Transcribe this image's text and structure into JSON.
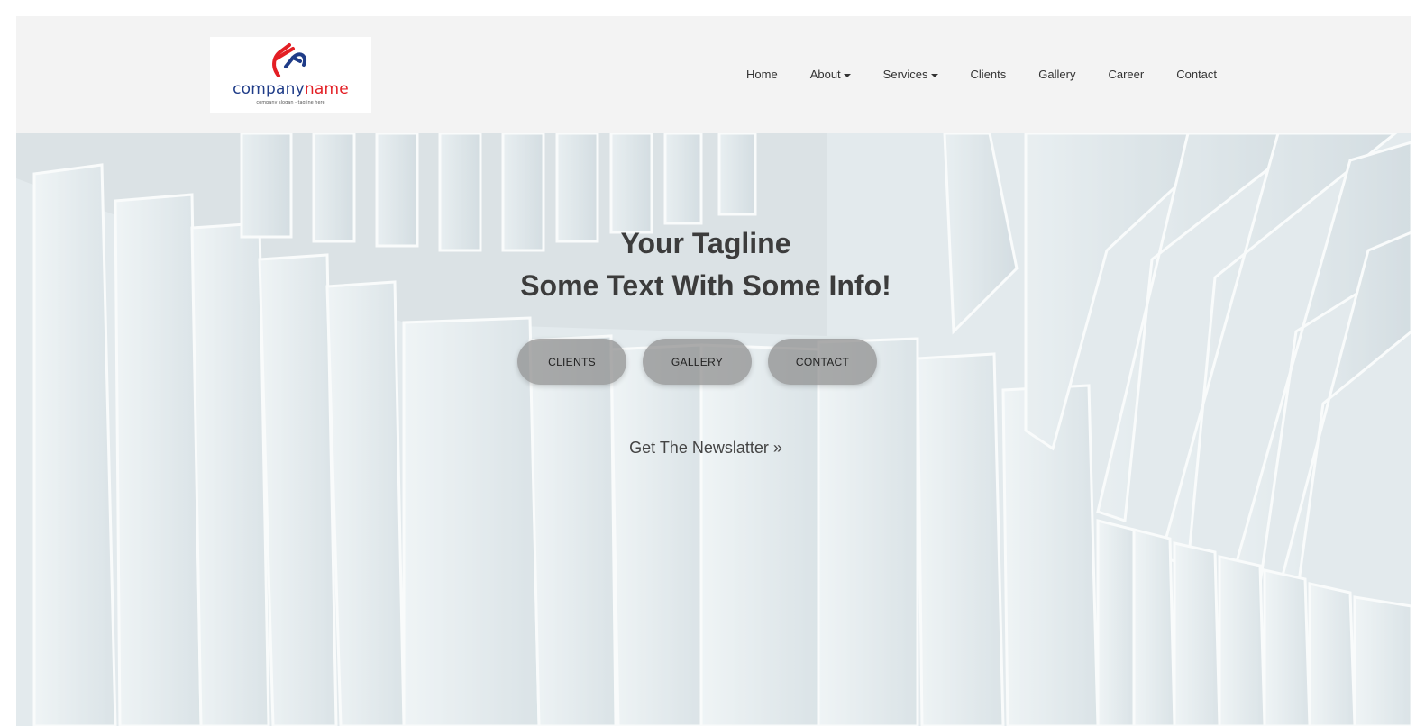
{
  "brand": {
    "name_part1": "company",
    "name_part2": "name",
    "slogan": "company slogan - tagline here"
  },
  "nav": {
    "items": [
      {
        "label": "Home",
        "dropdown": false
      },
      {
        "label": "About",
        "dropdown": true
      },
      {
        "label": "Services",
        "dropdown": true
      },
      {
        "label": "Clients",
        "dropdown": false
      },
      {
        "label": "Gallery",
        "dropdown": false
      },
      {
        "label": "Career",
        "dropdown": false
      },
      {
        "label": "Contact",
        "dropdown": false
      }
    ]
  },
  "hero": {
    "tagline_line1": "Your Tagline",
    "tagline_line2": "Some Text With Some Info!",
    "buttons": [
      "CLIENTS",
      "GALLERY",
      "CONTACT"
    ],
    "newsletter": "Get The Newslatter »"
  },
  "colors": {
    "brand_blue": "#1f3c88",
    "brand_red": "#e31e24",
    "navbar_bg": "#f3f3f3",
    "text_dark": "#3c3c3c"
  }
}
